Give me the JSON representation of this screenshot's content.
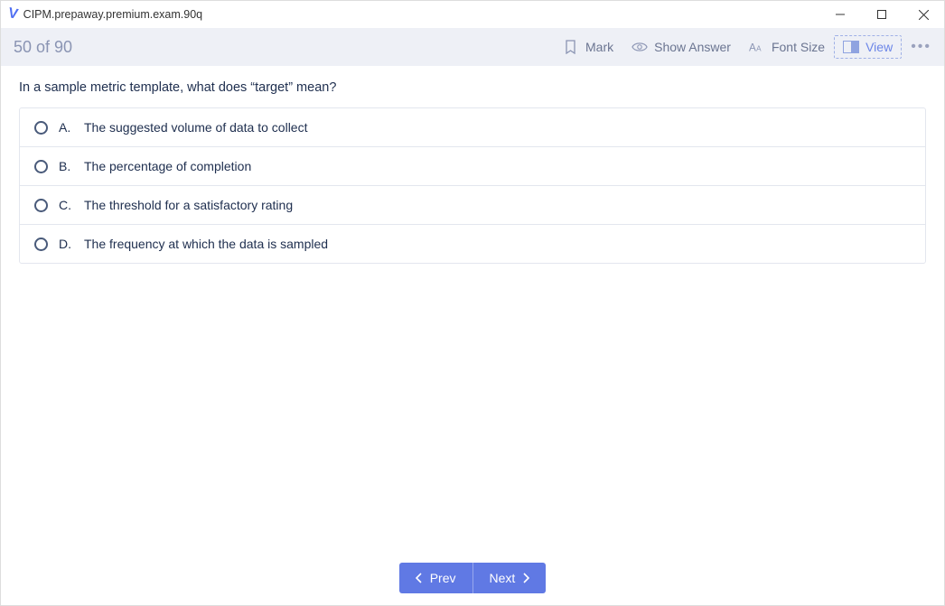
{
  "window": {
    "title": "CIPM.prepaway.premium.exam.90q"
  },
  "toolbar": {
    "progress": "50 of 90",
    "mark": "Mark",
    "show_answer": "Show Answer",
    "font_size": "Font Size",
    "view": "View"
  },
  "question": {
    "text": "In a sample metric template, what does “target” mean?",
    "options": [
      {
        "letter": "A.",
        "text": "The suggested volume of data to collect"
      },
      {
        "letter": "B.",
        "text": "The percentage of completion"
      },
      {
        "letter": "C.",
        "text": "The threshold for a satisfactory rating"
      },
      {
        "letter": "D.",
        "text": "The frequency at which the data is sampled"
      }
    ]
  },
  "nav": {
    "prev": "Prev",
    "next": "Next"
  }
}
